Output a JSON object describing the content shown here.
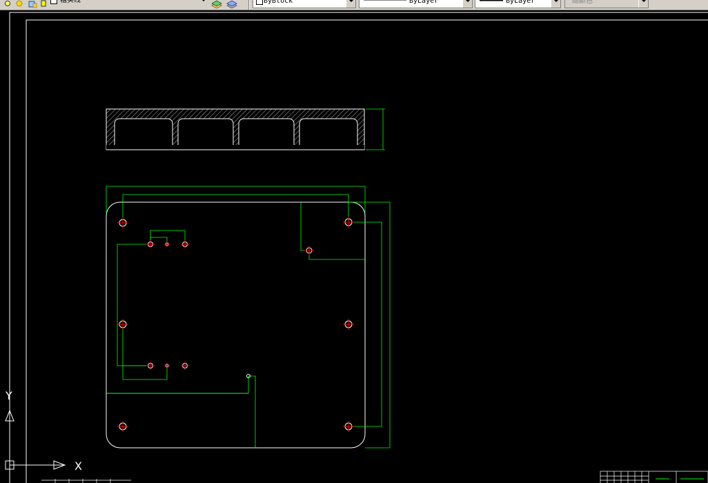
{
  "toolbar": {
    "layer_name": "粗实线",
    "color_control": "ByBlock",
    "linetype_control": "ByLayer",
    "lineweight_control": "ByLayer",
    "plotstyle_control": "随颜色"
  },
  "drawing": {
    "ucs_x_label": "X",
    "ucs_y_label": "Y"
  },
  "colors": {
    "canvas": "#000000",
    "drawing_lines": "#ffffff",
    "dimension_lines": "#00ff00",
    "center_marks": "#ff0000",
    "toolbar_bg": "#d4d0c8"
  }
}
